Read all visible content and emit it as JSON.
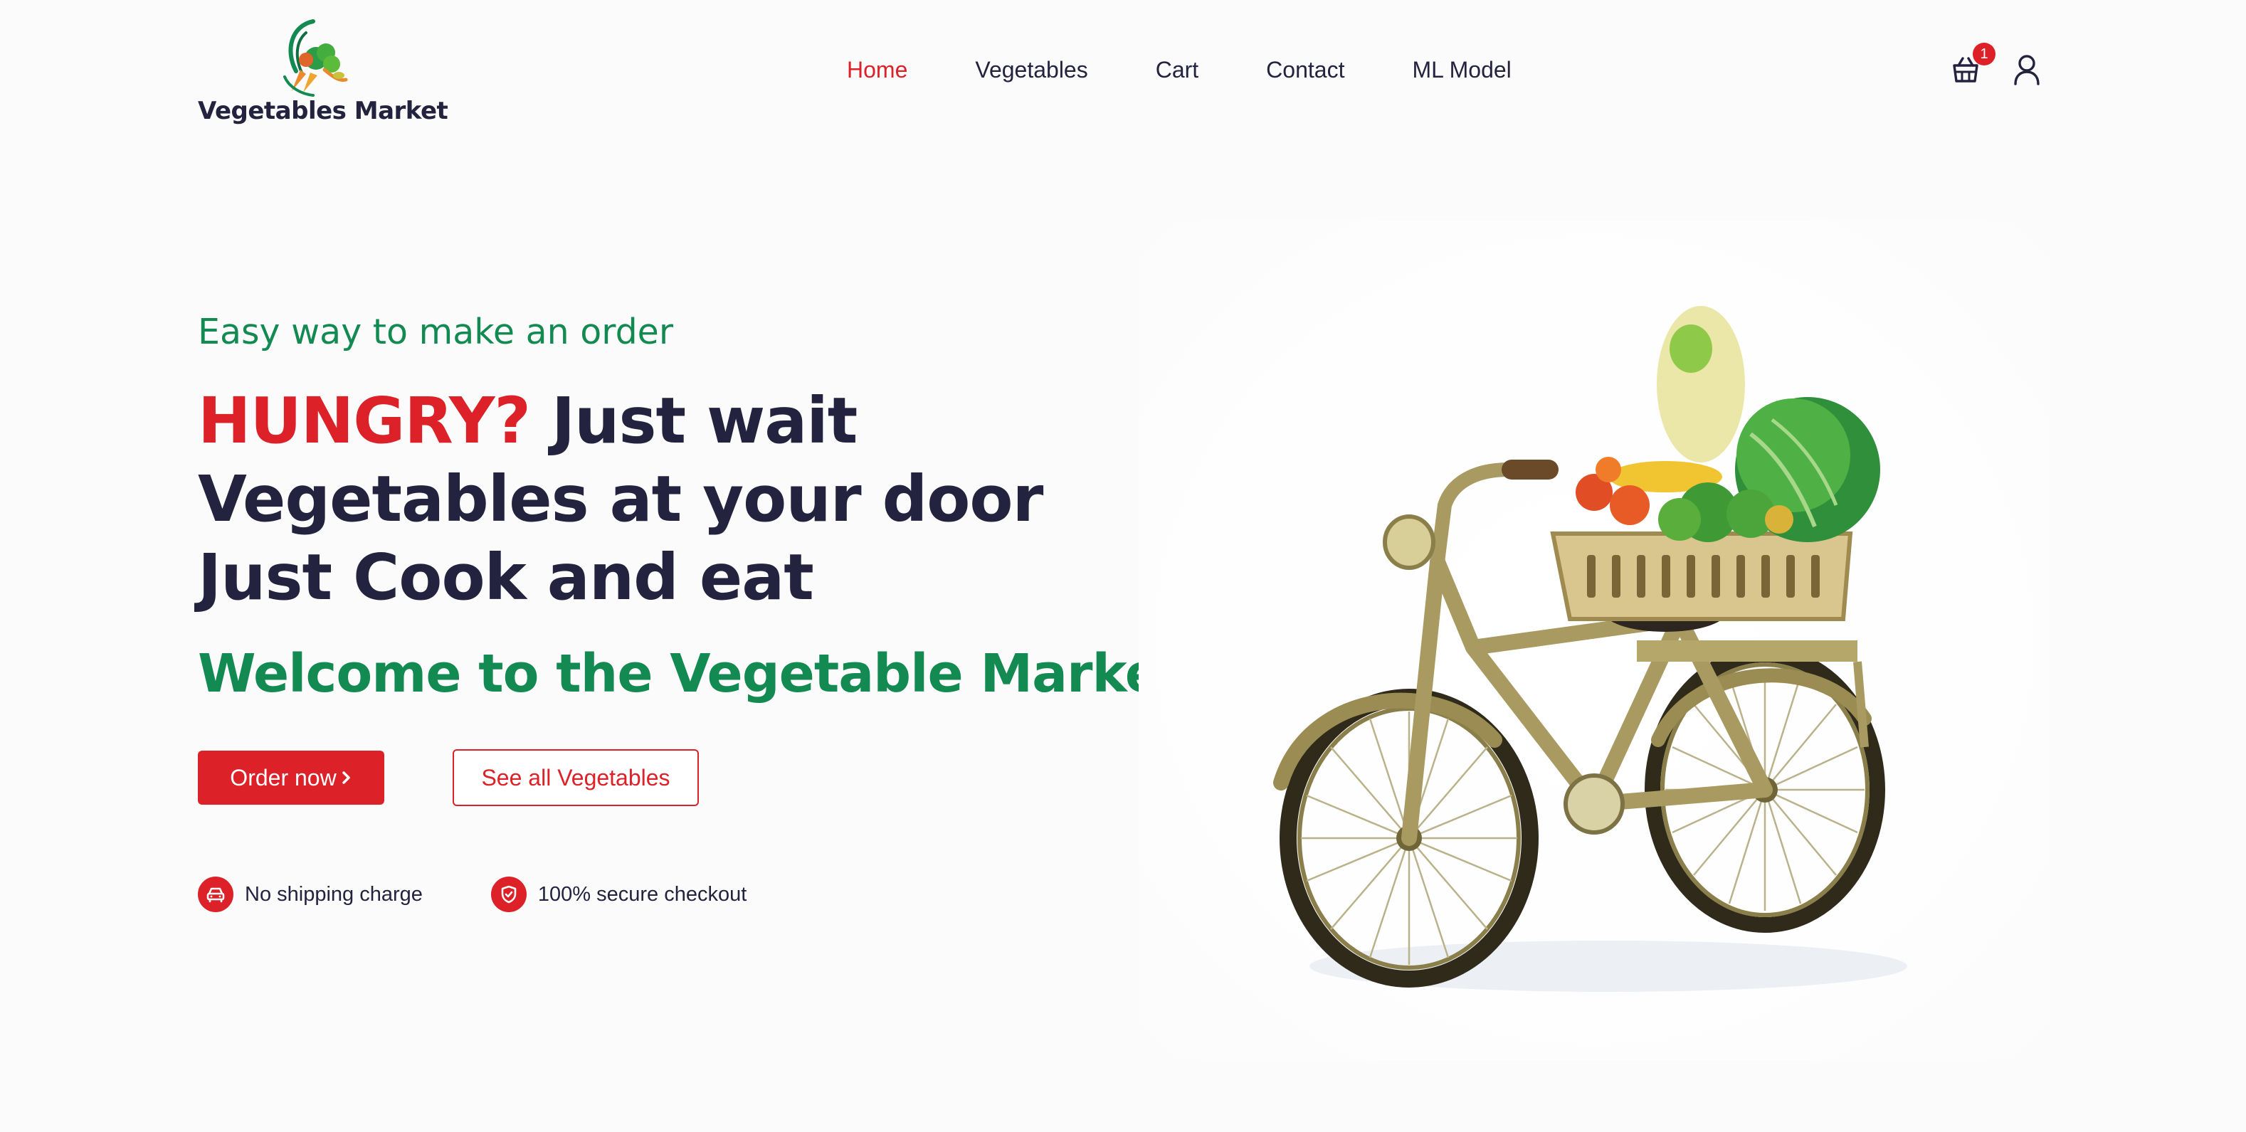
{
  "brand": {
    "name": "Vegetables Market"
  },
  "nav": {
    "items": [
      {
        "label": "Home",
        "active": true
      },
      {
        "label": "Vegetables",
        "active": false
      },
      {
        "label": "Cart",
        "active": false
      },
      {
        "label": "Contact",
        "active": false
      },
      {
        "label": "ML Model",
        "active": false
      }
    ]
  },
  "header_icons": {
    "cart_icon": "basket-icon",
    "cart_count": "1",
    "user_icon": "user-icon"
  },
  "hero": {
    "tagline": "Easy way to make an order",
    "headline_highlight": "HUNGRY?",
    "headline_rest": " Just wait Vegetables at your door Just Cook and eat",
    "welcome": "Welcome to the Vegetable Market",
    "order_button": "Order now",
    "order_button_icon": "chevron-right-icon",
    "see_all_button": "See all Vegetables",
    "features": [
      {
        "icon": "car-icon",
        "label": "No shipping charge"
      },
      {
        "icon": "shield-check-icon",
        "label": "100% secure checkout"
      }
    ],
    "image_subject": "bicycle-with-vegetable-basket"
  },
  "colors": {
    "accent_red": "#dd2128",
    "brand_green": "#138a52",
    "text_navy": "#23233f",
    "background": "#fbfbfb"
  }
}
